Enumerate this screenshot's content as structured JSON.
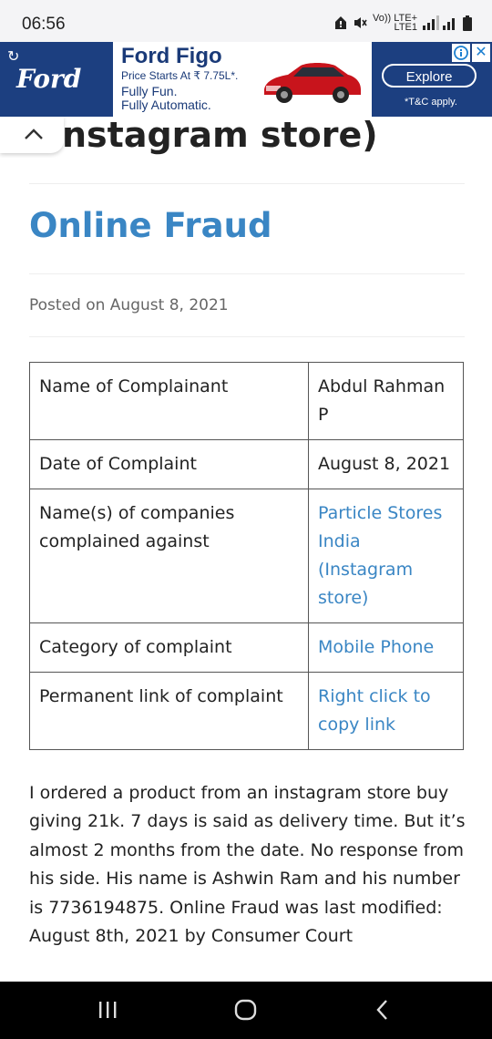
{
  "status_bar": {
    "time": "06:56",
    "network_label_top": "Vo)) LTE+",
    "network_label_bottom": "LTE1"
  },
  "ad": {
    "brand_logo_text": "Ford",
    "title": "Ford Figo",
    "line1": "Price Starts At ₹ 7.75L*.",
    "line2": "Fully Fun.",
    "line3": "Fully Automatic.",
    "cta": "Explore",
    "disclaimer": "*T&C apply.",
    "brand_color": "#1c3f80"
  },
  "article": {
    "previous_heading_fragment": "nstagram store)",
    "title": "Online Fraud",
    "posted_on": "Posted on August 8, 2021",
    "accent_color": "#3a86c4"
  },
  "table": {
    "rows": [
      {
        "label": "Name of Complainant",
        "value": "Abdul Rahman P"
      },
      {
        "label": "Date of Complaint",
        "value": "August 8, 2021"
      },
      {
        "label": "Name(s) of companies complained against",
        "value": "Particle Stores India (Instagram store)"
      },
      {
        "label": "Category of complaint",
        "value": "Mobile Phone"
      },
      {
        "label": "Permanent link of complaint",
        "value": "Right click to copy link"
      }
    ]
  },
  "body": {
    "text": "I ordered a product from an instagram store buy giving 21k. 7 days is said as delivery time. But it’s almost 2 months from the date. No response from his side. His name is Ashwin Ram and his number is 7736194875. Online Fraud was last modified: August 8th, 2021 by Consumer Court"
  },
  "icons": {
    "status": [
      "home-alert-icon",
      "mute-icon",
      "signal-icon",
      "battery-icon"
    ],
    "nav": [
      "recent-apps-icon",
      "home-icon",
      "back-icon"
    ]
  }
}
